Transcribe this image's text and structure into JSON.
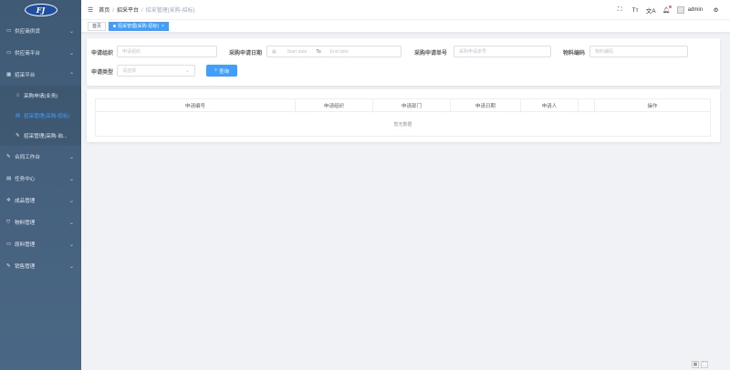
{
  "logo": {
    "text": "FJ"
  },
  "sidebar": {
    "items": [
      {
        "icon": "box-icon",
        "glyph": "▭",
        "label": "供应商供货",
        "chevron": "⌄"
      },
      {
        "icon": "box-icon",
        "glyph": "▭",
        "label": "供应商平台",
        "chevron": "⌄"
      },
      {
        "icon": "grid-icon",
        "glyph": "▦",
        "label": "招采平台",
        "chevron": "⌃"
      }
    ],
    "sub_items": [
      {
        "icon": "tree-icon",
        "glyph": "♤",
        "label": "采购申请(业务)"
      },
      {
        "icon": "list-icon",
        "glyph": "▤",
        "label": "招采管理(采购-招标)"
      },
      {
        "icon": "edit-icon",
        "glyph": "✎",
        "label": "招采管理(采购-询..."
      }
    ],
    "items2": [
      {
        "icon": "contract-icon",
        "glyph": "✎",
        "label": "合同工作台",
        "chevron": "⌄"
      },
      {
        "icon": "task-icon",
        "glyph": "▤",
        "label": "任务中心",
        "chevron": "⌄"
      },
      {
        "icon": "gear-icon",
        "glyph": "✲",
        "label": "成品管理",
        "chevron": "⌄"
      },
      {
        "icon": "shield-icon",
        "glyph": "⛉",
        "label": "物料管理",
        "chevron": "⌄"
      },
      {
        "icon": "raw-material-icon",
        "glyph": "▭",
        "label": "原料管理",
        "chevron": "⌄"
      },
      {
        "icon": "sales-icon",
        "glyph": "✎",
        "label": "销售管理",
        "chevron": "⌄"
      }
    ]
  },
  "header": {
    "breadcrumb": [
      "首页",
      "招采平台",
      "招采管理(采购-招标)"
    ],
    "username": "admin",
    "icons": {
      "fullscreen": "⛶",
      "font_size": "Tт",
      "translate": "文A",
      "bell": "🔔︎",
      "settings": "⚙"
    }
  },
  "tags": [
    {
      "label": "首页",
      "active": false
    },
    {
      "label": "招采管理(采购-招标)",
      "active": true,
      "close": "×"
    }
  ],
  "search": {
    "org_label": "申请组织",
    "org_placeholder": "申请组织",
    "date_label": "采购申请日期",
    "start_placeholder": "Start date",
    "to_text": "To",
    "end_placeholder": "End date",
    "request_no_label": "采购申请单号",
    "request_no_placeholder": "采购申请单号",
    "material_label": "物料编码",
    "material_placeholder": "物料编码",
    "type_label": "申请类型",
    "type_placeholder": "请选择",
    "query_button": "查询",
    "query_icon": "⌕",
    "calendar_icon": "▦"
  },
  "table": {
    "columns": [
      "申请编号",
      "申请组织",
      "申请部门",
      "申请日期",
      "申请人",
      "",
      "操作"
    ],
    "empty_text": "暂无数据"
  },
  "corner": {
    "qr": "▦",
    "expand": "⛶"
  }
}
